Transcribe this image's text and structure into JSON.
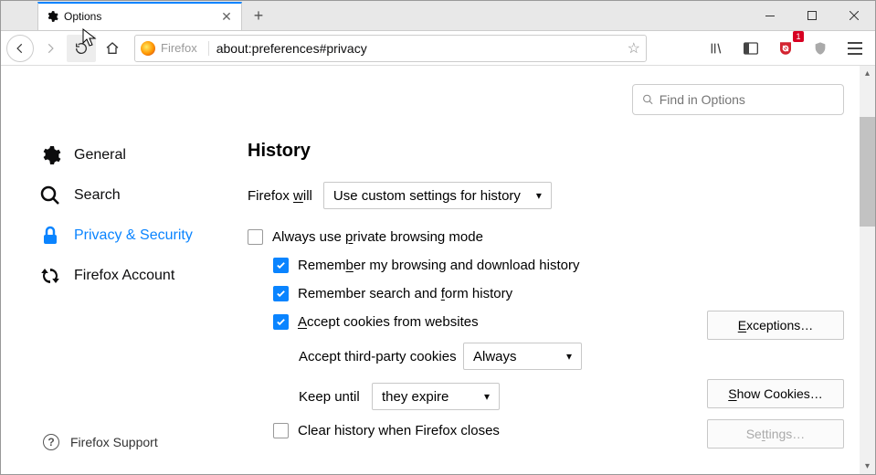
{
  "tab": {
    "title": "Options"
  },
  "url": {
    "site_label": "Firefox",
    "value": "about:preferences#privacy"
  },
  "ublock_badge": "1",
  "search": {
    "placeholder": "Find in Options"
  },
  "sidebar": {
    "general": "General",
    "search": "Search",
    "privacy": "Privacy & Security",
    "account": "Firefox Account",
    "support": "Firefox Support"
  },
  "history": {
    "heading": "History",
    "will_pre": "Firefox ",
    "will_u": "w",
    "will_post": "ill",
    "mode": "Use custom settings for history",
    "private_pre": "Always use ",
    "private_u": "p",
    "private_post": "rivate browsing mode",
    "remember_browse_pre": "Remem",
    "remember_browse_u": "b",
    "remember_browse_post": "er my browsing and download history",
    "remember_search_pre": "Remember search and ",
    "remember_search_u": "f",
    "remember_search_post": "orm history",
    "cookies_pre": "",
    "cookies_u": "A",
    "cookies_post": "ccept cookies from websites",
    "third_party_label": "Accept third-party cookies",
    "third_party_value": "Always",
    "keep_label": "Keep until",
    "keep_value": "they expire",
    "clear_label": "Clear history when Firefox closes",
    "btn_exceptions_u": "E",
    "btn_exceptions_post": "xceptions…",
    "btn_showcookies_pre": "",
    "btn_showcookies_u": "S",
    "btn_showcookies_post": "how Cookies…",
    "btn_settings_pre": "Se",
    "btn_settings_u": "t",
    "btn_settings_post": "tings…"
  }
}
